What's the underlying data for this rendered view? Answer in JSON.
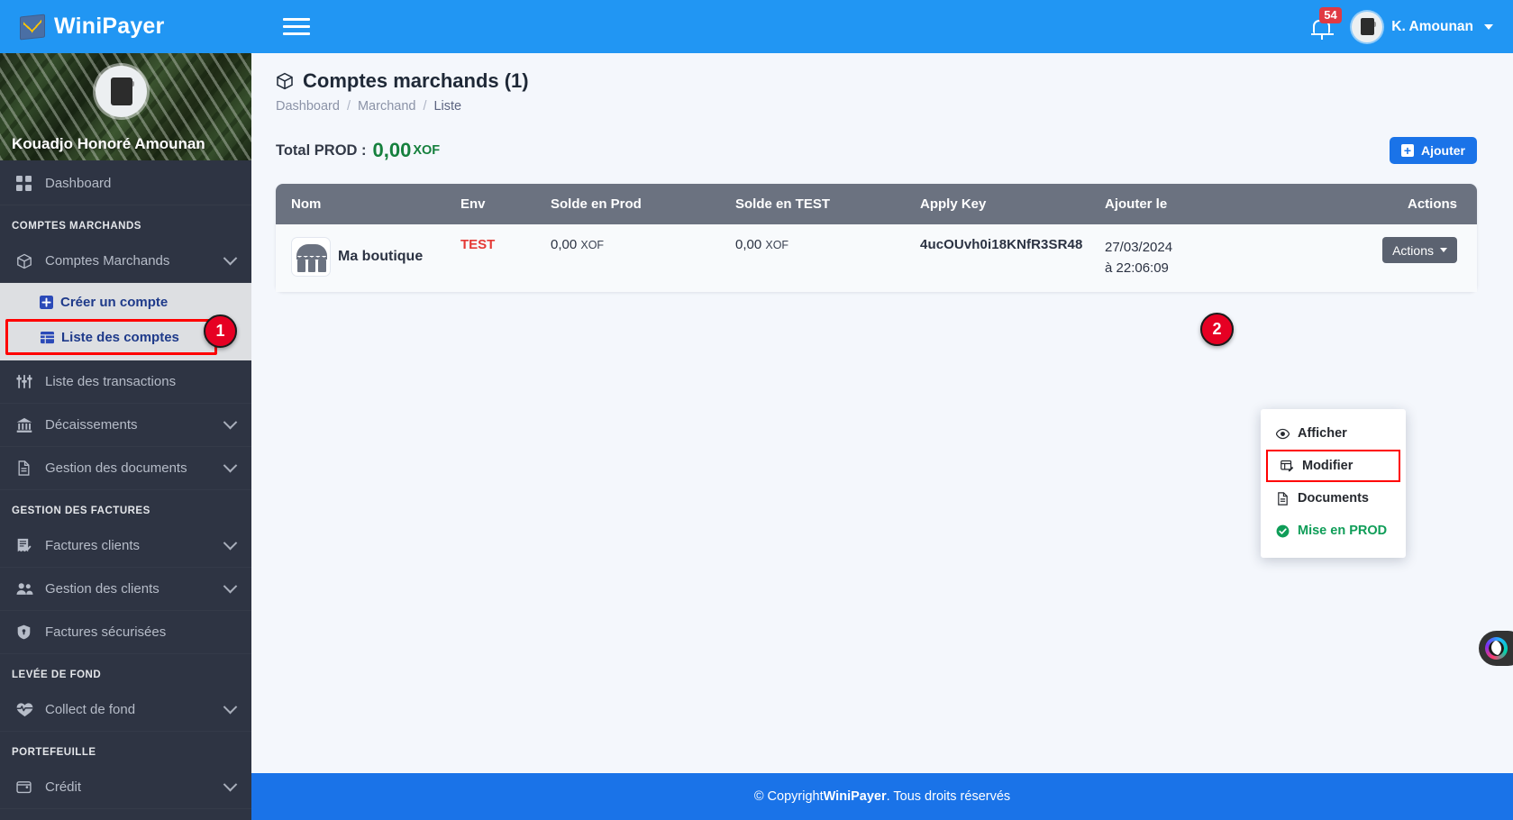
{
  "topbar": {
    "brand": "WiniPayer",
    "menu_toggle": "hamburger-menu",
    "notification_count": "54",
    "user_name": "K. Amounan"
  },
  "sidebar": {
    "profile_name": "Kouadjo Honoré Amounan",
    "dashboard": "Dashboard",
    "sections": [
      {
        "title": "COMPTES MARCHANDS",
        "items": [
          {
            "label": "Comptes Marchands",
            "icon": "box-icon",
            "expandable": true,
            "submenu": [
              {
                "label": "Créer un compte",
                "icon": "plus-square-icon",
                "highlighted": false
              },
              {
                "label": "Liste des comptes",
                "icon": "table-list-icon",
                "highlighted": true
              }
            ]
          },
          {
            "label": "Liste des transactions",
            "icon": "sliders-icon",
            "expandable": false
          },
          {
            "label": "Décaissements",
            "icon": "bank-icon",
            "expandable": true
          },
          {
            "label": "Gestion des documents",
            "icon": "file-icon",
            "expandable": true
          }
        ]
      },
      {
        "title": "GESTION DES FACTURES",
        "items": [
          {
            "label": "Factures clients",
            "icon": "receipt-check-icon",
            "expandable": true
          },
          {
            "label": "Gestion des clients",
            "icon": "users-icon",
            "expandable": true
          },
          {
            "label": "Factures sécurisées",
            "icon": "shield-lock-icon",
            "expandable": false
          }
        ]
      },
      {
        "title": "LEVÉE DE FOND",
        "items": [
          {
            "label": "Collect de fond",
            "icon": "heart-pulse-icon",
            "expandable": true
          }
        ]
      },
      {
        "title": "PORTEFEUILLE",
        "items": [
          {
            "label": "Crédit",
            "icon": "wallet-icon",
            "expandable": true
          }
        ]
      }
    ]
  },
  "main": {
    "page_title": "Comptes marchands (1)",
    "page_title_icon": "box-icon",
    "breadcrumb": [
      {
        "label": "Dashboard",
        "current": false
      },
      {
        "label": "Marchand",
        "current": false
      },
      {
        "label": "Liste",
        "current": true
      }
    ],
    "breadcrumb_sep": "/",
    "total_label": "Total PROD :",
    "total_value": "0,00",
    "total_currency": "XOF",
    "add_button": "Ajouter",
    "add_button_icon": "plus-square-icon",
    "table": {
      "columns": [
        "Nom",
        "Env",
        "Solde en Prod",
        "Solde en TEST",
        "Apply Key",
        "Ajouter le",
        "Actions"
      ],
      "rows": [
        {
          "nom": "Ma boutique",
          "nom_icon": "shop-icon",
          "env": "TEST",
          "solde_prod": "0,00",
          "solde_prod_currency": "XOF",
          "solde_test": "0,00",
          "solde_test_currency": "XOF",
          "apply_key": "4ucOUvh0i18KNfR3SR48",
          "date_line1": "27/03/2024",
          "date_line2": "à 22:06:09",
          "actions_label": "Actions"
        }
      ]
    },
    "dropdown": {
      "items": [
        {
          "label": "Afficher",
          "icon": "eye-icon",
          "highlighted": false,
          "style": "dark"
        },
        {
          "label": "Modifier",
          "icon": "edit-table-icon",
          "highlighted": true,
          "style": "dark"
        },
        {
          "label": "Documents",
          "icon": "file-icon",
          "highlighted": false,
          "style": "dark"
        },
        {
          "label": "Mise en PROD",
          "icon": "check-circle-icon",
          "highlighted": false,
          "style": "green"
        }
      ]
    },
    "steps": [
      {
        "number": "1"
      },
      {
        "number": "2"
      }
    ]
  },
  "footer": {
    "copyright_prefix": "© Copyright ",
    "brand": "WiniPayer",
    "copyright_suffix": ". Tous droits réservés"
  },
  "chat_widget": {
    "icon": "chat-face-icon"
  },
  "colors": {
    "primary": "#2196f3",
    "footer_blue": "#1a73e8",
    "sidebar": "#2e3443",
    "table_header": "#6b7280",
    "danger": "#e53935",
    "success": "#15803d",
    "highlight": "#ff0000",
    "step_badge": "#e60023"
  }
}
